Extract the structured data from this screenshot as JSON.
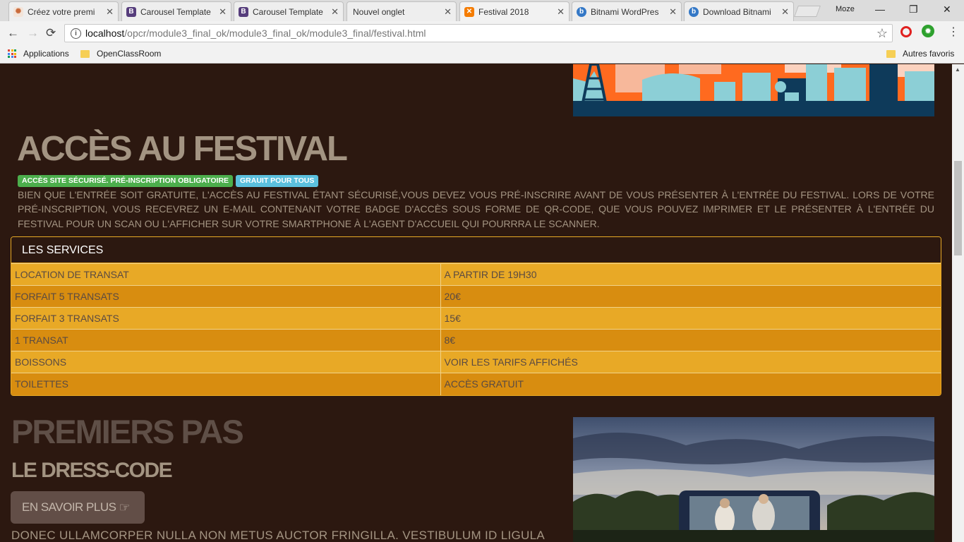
{
  "browser": {
    "tabs": [
      {
        "title": "Créez votre premi",
        "close": "✕",
        "favicon": "",
        "color": "#e08a5a"
      },
      {
        "title": "Carousel Template",
        "close": "✕",
        "favicon": "B",
        "color": "#563d7c"
      },
      {
        "title": "Carousel Template",
        "close": "✕",
        "favicon": "B",
        "color": "#563d7c"
      },
      {
        "title": "Nouvel onglet",
        "close": "✕",
        "favicon": "",
        "color": "#eeeeee"
      },
      {
        "title": "Festival 2018",
        "close": "✕",
        "favicon": "",
        "color": "#f57c00"
      },
      {
        "title": "Bitnami WordPres",
        "close": "✕",
        "favicon": "",
        "color": "#3478c6"
      },
      {
        "title": "Download Bitnami",
        "close": "✕",
        "favicon": "",
        "color": "#3478c6"
      }
    ],
    "profile": "Moze",
    "window_controls": {
      "minimize": "—",
      "maximize": "❐",
      "close": "✕"
    },
    "nav": {
      "back": "←",
      "forward": "→",
      "reload": "⟳"
    },
    "url_host": "localhost",
    "url_path": "/opcr/module3_final_ok/module3_final_ok/module3_final/festival.html",
    "bookmarks": {
      "apps": "Applications",
      "openclassroom": "OpenClassRoom",
      "others": "Autres favoris"
    }
  },
  "page": {
    "access": {
      "title": "ACCÈS AU FESTIVAL",
      "badges": [
        {
          "label": "ACCÈS SITE SÉCURISÉ. PRÉ-INSCRIPTION OBLIGATOIRE",
          "color": "#4cae4c"
        },
        {
          "label": "GRAUIT POUR TOUS",
          "color": "#5bc0de"
        }
      ],
      "text": "Bien que l'entrée soit gratuite, l'accès au festival étant sécurisé,vous devez vous pré-inscrire avant de vous présenter à l'entrée du festival. Lors de votre pré-inscription, vous recevrez un e-mail contenant votre badge d'accès sous forme de QR-code, que vous pouvez imprimer et le présenter à l'entrée du festival pour un scan ou l'afficher sur votre smartphone à l'agent d'accueil qui pourrra le scanner."
    },
    "services": {
      "heading": "LES SERVICES",
      "rows": [
        {
          "service": "LOCATION DE TRANSAT",
          "price": "A PARTIR DE 19H30"
        },
        {
          "service": "FORFAIT 5 TRANSATS",
          "price": "20€"
        },
        {
          "service": "FORFAIT 3 TRANSATS",
          "price": "15€"
        },
        {
          "service": "1 TRANSAT",
          "price": "8€"
        },
        {
          "service": "BOISSONS",
          "price": "VOIR LES TARIFS AFFICHÉS"
        },
        {
          "service": "TOILETTES",
          "price": "ACCÈS GRATUIT"
        }
      ]
    },
    "premiers": {
      "title": "PREMIERS PAS",
      "subtitle": "LE DRESS-CODE",
      "button": "EN SAVOIR PLUS",
      "button_icon": "hand-pointing-right-icon",
      "text": "Donec ullamcorper nulla non metus auctor fringilla. Vestibulum id ligula"
    },
    "colors": {
      "background": "#2c1810",
      "accent": "#e8a926",
      "accent_dark": "#d88d10",
      "text": "#a39482"
    }
  }
}
